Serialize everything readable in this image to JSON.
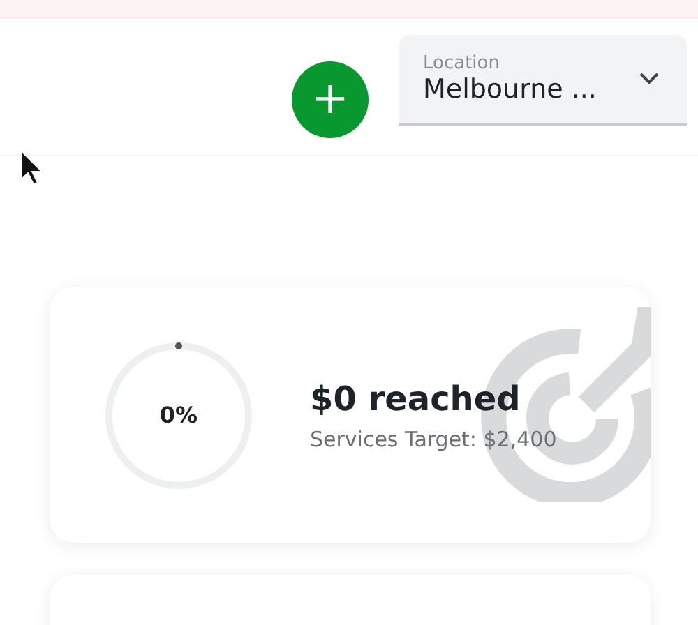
{
  "header": {
    "add_button": "+",
    "location": {
      "label": "Location",
      "value": "Melbourne ..."
    }
  },
  "target_card": {
    "progress": {
      "level": 0,
      "reading": "0%"
    },
    "amount": "$0 reached",
    "target": "Services Target: $2,400"
  }
}
